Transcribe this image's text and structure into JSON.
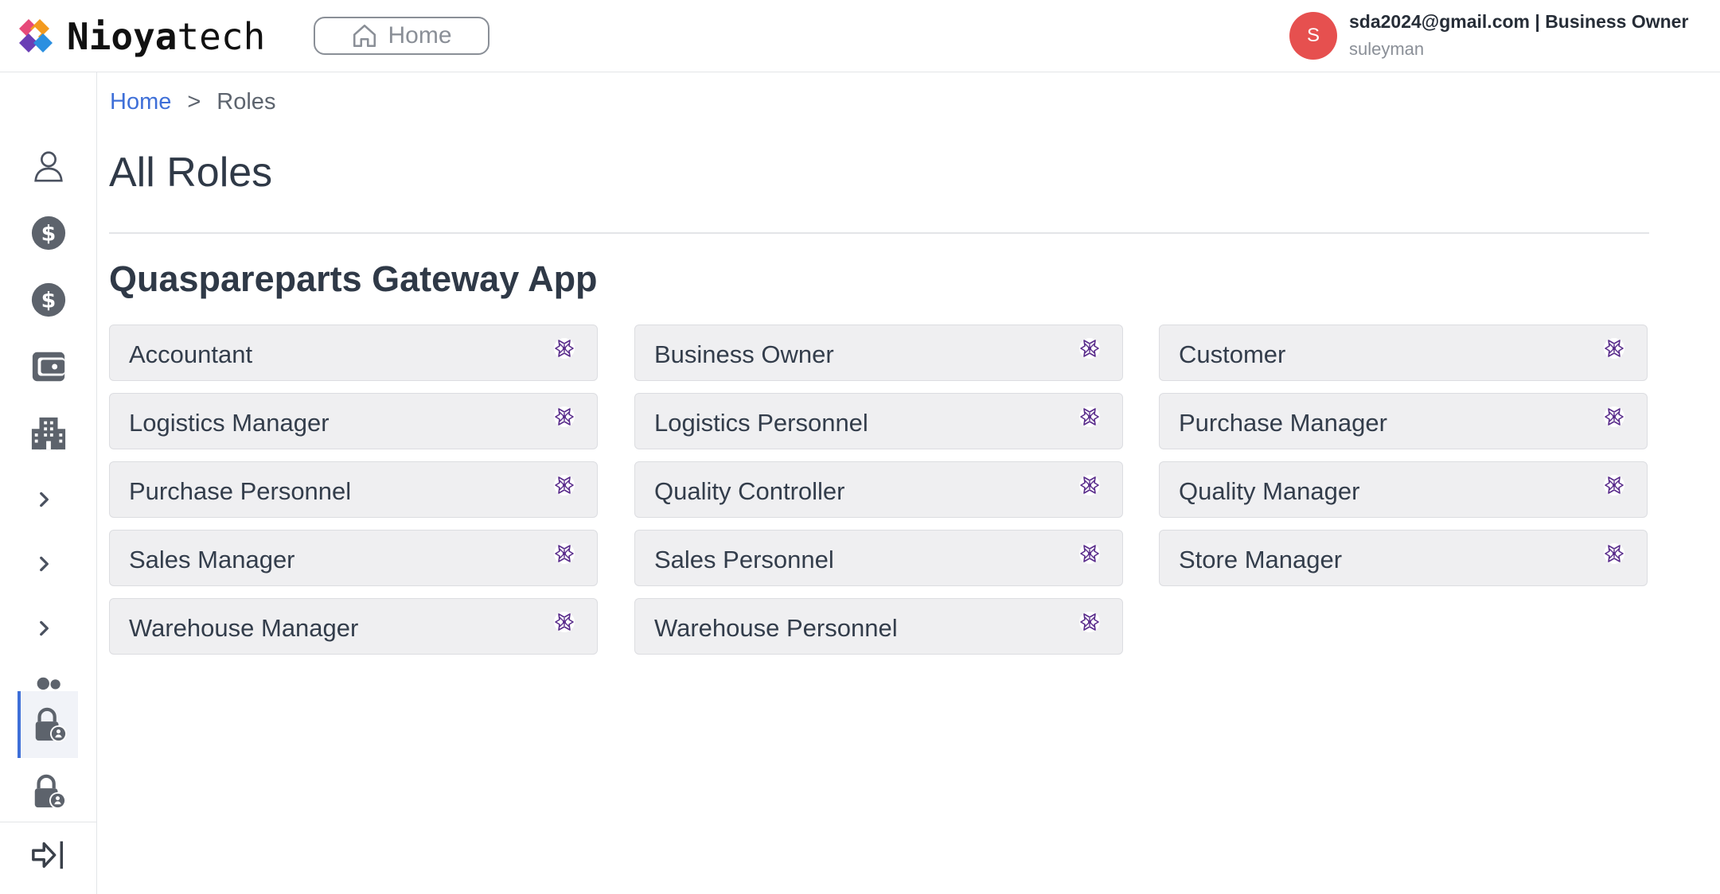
{
  "header": {
    "logo_bold": "Nioya",
    "logo_light": "tech",
    "home_label": "Home",
    "avatar_initial": "S",
    "user_email_role": "sda2024@gmail.com | Business Owner",
    "user_name": "suleyman"
  },
  "sidebar": {
    "items": [
      {
        "icon": "user-outline-icon"
      },
      {
        "icon": "dollar-circle-icon"
      },
      {
        "icon": "dollar-circle-icon"
      },
      {
        "icon": "wallet-icon"
      },
      {
        "icon": "building-icon"
      },
      {
        "icon": "chevron-right-icon"
      },
      {
        "icon": "chevron-right-icon"
      },
      {
        "icon": "chevron-right-icon"
      },
      {
        "icon": "users-icon"
      },
      {
        "icon": "lock-user-icon",
        "active": true
      },
      {
        "icon": "lock-user-icon"
      },
      {
        "icon": "collapse-sidebar-icon"
      }
    ],
    "active_color": "#3e6fd8"
  },
  "breadcrumb": {
    "home": "Home",
    "separator": ">",
    "current": "Roles"
  },
  "page": {
    "title": "All Roles",
    "section_title": "Quaspareparts Gateway App"
  },
  "roles": [
    "Accountant",
    "Business Owner",
    "Customer",
    "Logistics Manager",
    "Logistics Personnel",
    "Purchase Manager",
    "Purchase Personnel",
    "Quality Controller",
    "Quality Manager",
    "Sales Manager",
    "Sales Personnel",
    "Store Manager",
    "Warehouse Manager",
    "Warehouse Personnel"
  ],
  "role_icon": "role-settings-icon",
  "colors": {
    "link": "#3e6fd8",
    "avatar": "#e6504f",
    "role_icon": "#5a2d8c"
  }
}
